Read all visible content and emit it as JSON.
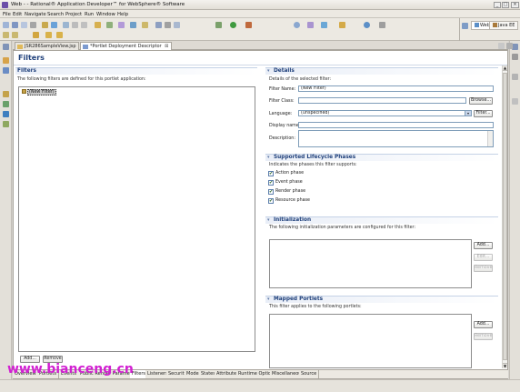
{
  "window": {
    "title": "Web - - Rational® Application Developer™ for WebSphere® Software"
  },
  "menu": [
    "File",
    "Edit",
    "Navigate",
    "Search",
    "Project",
    "Run",
    "Window",
    "Help"
  ],
  "perspectives": [
    "Web",
    "Java EE"
  ],
  "editor_tabs": [
    {
      "label": "JSR286SampleView.jsp"
    },
    {
      "label": "*Portlet Deployment Descriptor",
      "close": "⊠"
    }
  ],
  "form": {
    "title": "Filters",
    "filters_section": {
      "title": "Filters",
      "description": "The following filters are defined for this portlet application:",
      "items": [
        "(New Filter)"
      ],
      "add_label": "Add...",
      "remove_label": "Remove"
    },
    "details": {
      "title": "Details",
      "description": "Details of the selected filter:",
      "filter_name_label": "Filter Name:",
      "filter_name_value": "(New Filter)",
      "filter_class_label": "Filter Class:",
      "filter_class_value": "",
      "browse_label": "Browse...",
      "language_label": "Language:",
      "language_value": "(unspecified)",
      "filter_button_label": "Filter...",
      "display_name_label": "Display name:",
      "display_name_value": "",
      "description_label": "Description:"
    },
    "lifecycle": {
      "title": "Supported Lifecycle Phases",
      "description": "Indicates the phases this filter supports:",
      "phases": [
        {
          "label": "Action phase",
          "checked": true
        },
        {
          "label": "Event phase",
          "checked": true
        },
        {
          "label": "Render phase",
          "checked": true
        },
        {
          "label": "Resource phase",
          "checked": true
        }
      ]
    },
    "initialization": {
      "title": "Initialization",
      "description": "The following initialization parameters are configured for this filter:",
      "add_label": "Add...",
      "edit_label": "Edit...",
      "remove_label": "Remove"
    },
    "mapped_portlets": {
      "title": "Mapped Portlets",
      "description": "This filter applies to the following portlets:",
      "add_label": "Add...",
      "remove_label": "Remove"
    }
  },
  "bottom_tabs": [
    "Overview",
    "Portlets",
    "Events",
    "Public Render Parameters",
    "Filters",
    "Listeners",
    "Security",
    "Modes",
    "States",
    "Attributes",
    "Runtime Options",
    "Miscellaneous",
    "Source"
  ],
  "watermark": "www.bianceng.cn"
}
